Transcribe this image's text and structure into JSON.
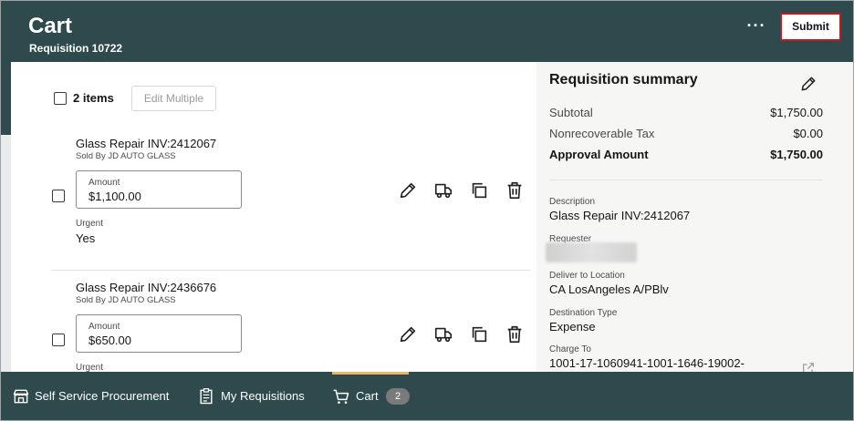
{
  "header": {
    "title": "Cart",
    "subtitle": "Requisition 10722",
    "more_label": "···",
    "submit_label": "Submit"
  },
  "cart": {
    "items_count": "2 items",
    "edit_multiple_label": "Edit Multiple",
    "lines": [
      {
        "name": "Glass Repair INV:2412067",
        "seller": "Sold By JD AUTO GLASS",
        "amount_label": "Amount",
        "amount": "$1,100.00",
        "urgent_label": "Urgent",
        "urgent_value": "Yes"
      },
      {
        "name": "Glass Repair INV:2436676",
        "seller": "Sold By JD AUTO GLASS",
        "amount_label": "Amount",
        "amount": "$650.00",
        "urgent_label": "Urgent"
      }
    ]
  },
  "summary": {
    "title": "Requisition summary",
    "subtotal_label": "Subtotal",
    "subtotal": "$1,750.00",
    "tax_label": "Nonrecoverable Tax",
    "tax": "$0.00",
    "approval_label": "Approval Amount",
    "approval": "$1,750.00",
    "description_label": "Description",
    "description": "Glass Repair INV:2412067",
    "requester_label": "Requester",
    "deliver_label": "Deliver to Location",
    "deliver": "CA LosAngeles A/PBlv",
    "destination_label": "Destination Type",
    "destination": "Expense",
    "charge_label": "Charge To",
    "charge": "1001-17-1060941-1001-1646-19002-"
  },
  "nav": {
    "self_service": "Self Service Procurement",
    "my_requisitions": "My Requisitions",
    "cart": "Cart",
    "cart_count": "2"
  },
  "colors": {
    "header_bg": "#2f4a4c",
    "submit_border": "#c6171e",
    "active_tab": "#e7b76a"
  }
}
